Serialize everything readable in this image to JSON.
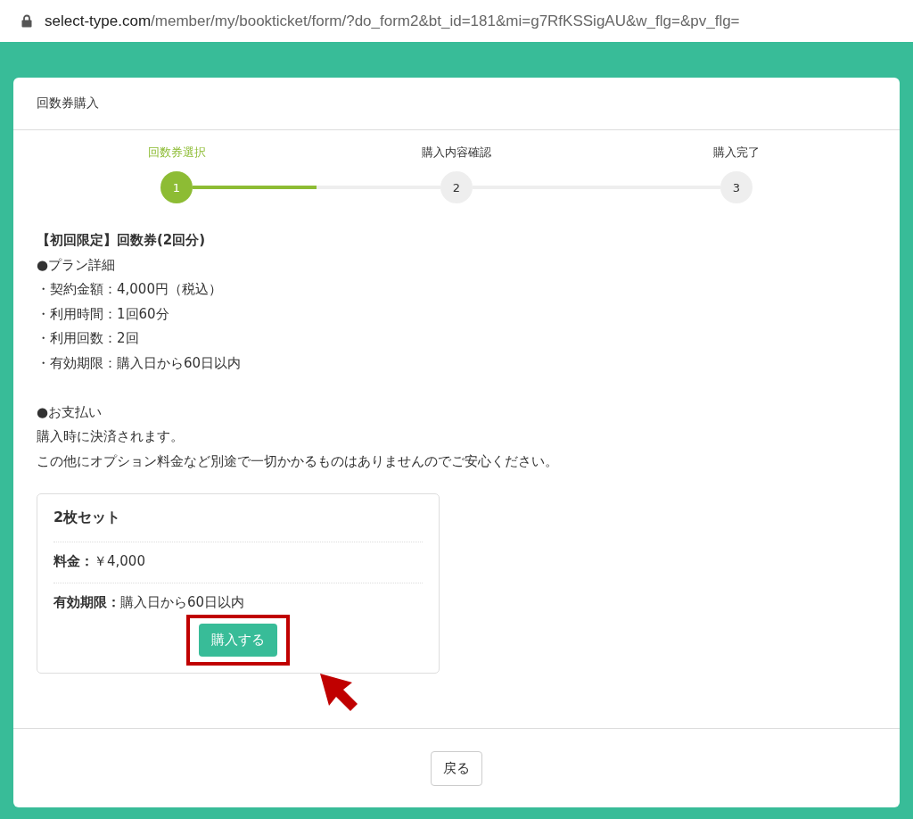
{
  "address_bar": {
    "domain": "select-type.com",
    "path": "/member/my/bookticket/form/?do_form2&bt_id=181&mi=g7RfKSSigAU&w_flg=&pv_flg="
  },
  "panel": {
    "title": "回数券購入"
  },
  "steps": [
    {
      "label": "回数券選択",
      "number": "1",
      "selected": true
    },
    {
      "label": "購入内容確認",
      "number": "2",
      "selected": false
    },
    {
      "label": "購入完了",
      "number": "3",
      "selected": false
    }
  ],
  "progress_segments": [
    {
      "level": 0.5
    },
    {
      "level": 0
    }
  ],
  "description": {
    "title": "【初回限定】回数券(2回分)",
    "blocks": [
      [
        "●プラン詳細",
        "・契約金額：4,000円（税込）",
        "・利用時間：1回60分",
        "・利用回数：2回",
        "・有効期限：購入日から60日以内"
      ],
      [
        "●お支払い",
        "購入時に決済されます。",
        "この他にオプション料金など別途で一切かかるものはありませんのでご安心ください。"
      ]
    ]
  },
  "plan": {
    "name": "2枚セット",
    "fields": [
      {
        "label": "料金：",
        "value": "￥4,000"
      },
      {
        "label": "有効期限：",
        "value": "購入日から60日以内"
      }
    ],
    "buy_button": {
      "label": "購入する",
      "highlighted": true
    }
  },
  "back_button": "戻る"
}
